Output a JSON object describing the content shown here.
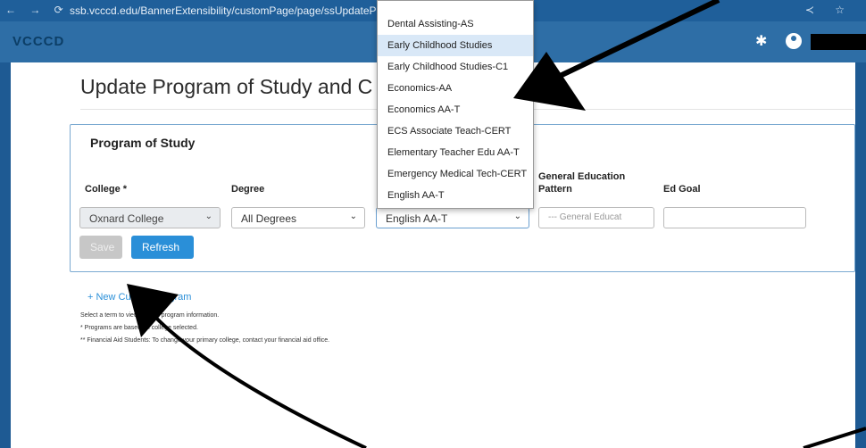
{
  "browser": {
    "url": "ssb.vcccd.edu/BannerExtensibility/customPage/page/ssUpdatePr"
  },
  "app": {
    "logo": "VCCCD"
  },
  "page": {
    "title": "Update Program of Study and C"
  },
  "card": {
    "title": "Program of Study",
    "columns": {
      "college": "College *",
      "degree": "Degree",
      "gep_line1": "General Education",
      "gep_line2": "Pattern",
      "ed_goal": "Ed Goal"
    },
    "college_value": "Oxnard College",
    "degree_value": "All Degrees",
    "program_value": "English AA-T",
    "gep_value": "--- General Educat",
    "ed_goal_value": ""
  },
  "buttons": {
    "save": "Save",
    "refresh": "Refresh"
  },
  "links": {
    "new_program": "+ New Current Program"
  },
  "notes": {
    "line1": "Select a term to view current program information.",
    "line2": "* Programs are based on college selected.",
    "line3": "** Financial Aid Students: To change your primary college, contact your financial aid office."
  },
  "dropdown": {
    "items": [
      "Dental Assisting-AS",
      "Early Childhood Studies",
      "Early Childhood Studies-C1",
      "Economics-AA",
      "Economics AA-T",
      "ECS Associate Teach-CERT",
      "Elementary Teacher Edu AA-T",
      "Emergency Medical Tech-CERT",
      "English AA-T"
    ],
    "highlighted_index": 1
  }
}
